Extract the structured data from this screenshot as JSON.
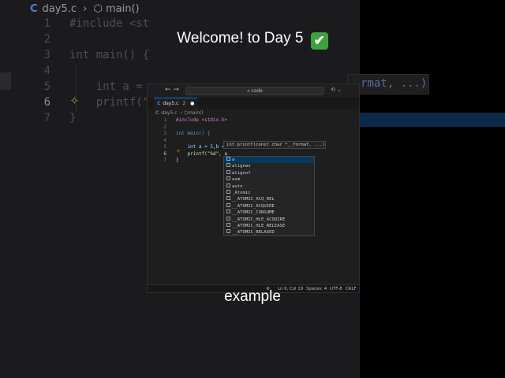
{
  "background_editor": {
    "breadcrumb_file": "day5.c",
    "breadcrumb_symbol": "main()",
    "lines": [
      {
        "n": "1",
        "code": "#include <st"
      },
      {
        "n": "2",
        "code": ""
      },
      {
        "n": "3",
        "code": "int main() {"
      },
      {
        "n": "4",
        "code": ""
      },
      {
        "n": "5",
        "code": "    int a ="
      },
      {
        "n": "6",
        "code": "    printf(\""
      },
      {
        "n": "7",
        "code": "}"
      }
    ],
    "right_fragment": "rmat, ...)"
  },
  "title": {
    "text": "Welcome! to Day 5",
    "emoji": "✔"
  },
  "window": {
    "search_placeholder": "code",
    "tab_label": "day5.c",
    "tab_number": "2",
    "breadcrumb_file": "day5.c",
    "breadcrumb_symbol": "main()",
    "lines": [
      {
        "n": "1",
        "code": "#include <stdio.h>"
      },
      {
        "n": "2",
        "code": ""
      },
      {
        "n": "3",
        "code": "int main() {"
      },
      {
        "n": "4",
        "code": ""
      },
      {
        "n": "5",
        "code": "    int a = 5,b ="
      },
      {
        "n": "6",
        "code": "    printf(\"%d\", a"
      },
      {
        "n": "7",
        "code": "}"
      }
    ],
    "hint": "int printf(const char *__format, ...)",
    "suggestions": [
      "a",
      "alignas",
      "alignof",
      "asm",
      "auto",
      "_Atomic",
      "__ATOMIC_ACQ_REL",
      "__ATOMIC_ACQUIRE",
      "__ATOMIC_CONSUME",
      "__ATOMIC_HLE_ACQUIRE",
      "__ATOMIC_HLE_RELEASE",
      "__ATOMIC_RELAXED"
    ],
    "status": {
      "position": "Ln 6, Col 19",
      "spaces": "Spaces: 4",
      "encoding": "UTF-8",
      "eol": "CRLF"
    }
  },
  "caption": "example"
}
